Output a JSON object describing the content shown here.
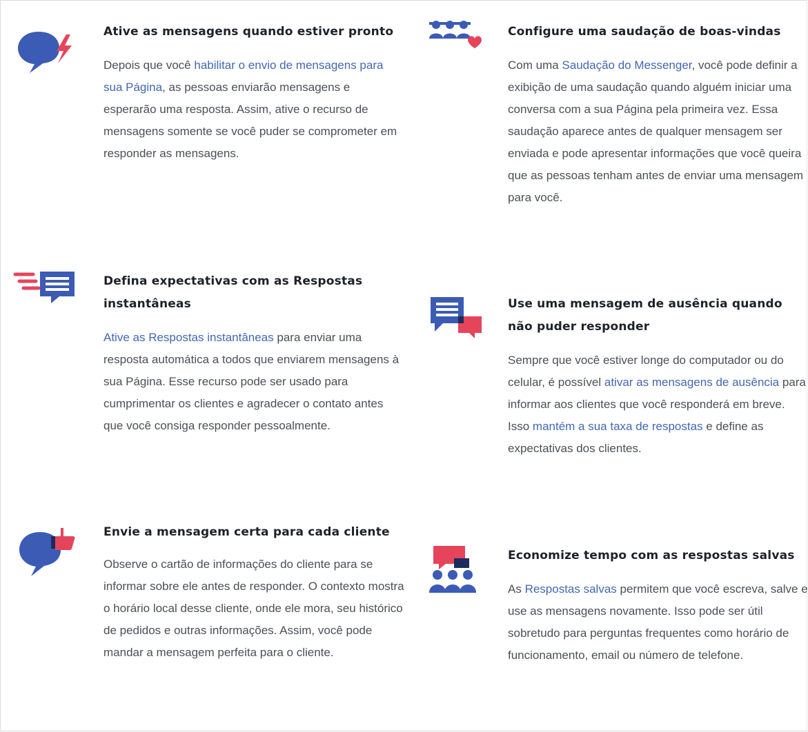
{
  "colors": {
    "link": "#4267b2",
    "icon_blue": "#3b5bb5",
    "icon_red": "#e5445b",
    "title": "#1d2129",
    "body": "#4b4f56"
  },
  "features": [
    {
      "icon": "chat-bubble-lightning-icon",
      "title": "Ative as mensagens quando estiver pronto",
      "body": [
        {
          "t": "Depois que você "
        },
        {
          "t": "habilitar o envio de mensagens para sua Página",
          "link": true
        },
        {
          "t": ", as pessoas enviarão mensagens e esperarão uma resposta. Assim, ative o recurso de mensagens somente se você puder se comprometer em responder as mensagens."
        }
      ]
    },
    {
      "icon": "instant-reply-icon",
      "title": "Defina expectativas com as Respostas instantâneas",
      "body": [
        {
          "t": "Ative as Respostas instantâneas",
          "link": true
        },
        {
          "t": " para enviar uma resposta automática a todos que enviarem mensagens à sua Página. Esse recurso pode ser usado para cumprimentar os clientes e agradecer o contato antes que você consiga responder pessoalmente."
        }
      ]
    },
    {
      "icon": "chat-bubble-thumbs-up-icon",
      "title": "Envie a mensagem certa para cada cliente",
      "body": [
        {
          "t": "Observe o cartão de informações do cliente para se informar sobre ele antes de responder. O contexto mostra o horário local desse cliente, onde ele mora, seu histórico de pedidos e outras informações. Assim, você pode mandar a mensagem perfeita para o cliente."
        }
      ]
    },
    {
      "icon": "people-heart-icon",
      "title": "Configure uma saudação de boas-vindas",
      "body": [
        {
          "t": "Com uma "
        },
        {
          "t": "Saudação do Messenger",
          "link": true
        },
        {
          "t": ", você pode definir a exibição de uma saudação quando alguém iniciar uma conversa com a sua Página pela primeira vez. Essa saudação aparece antes de qualquer mensagem ser enviada e pode apresentar informações que você queira que as pessoas tenham antes de enviar uma mensagem para você."
        }
      ]
    },
    {
      "icon": "away-message-icon",
      "title": "Use uma mensagem de ausência quando não puder responder",
      "body": [
        {
          "t": "Sempre que você estiver longe do computador ou do celular, é possível "
        },
        {
          "t": "ativar as mensagens de ausência",
          "link": true
        },
        {
          "t": " para informar aos clientes que você responderá em breve. Isso "
        },
        {
          "t": "mantém a sua taxa de respostas",
          "link": true
        },
        {
          "t": " e define as expectativas dos clientes."
        }
      ]
    },
    {
      "icon": "saved-replies-group-icon",
      "title": "Economize tempo com as respostas salvas",
      "body": [
        {
          "t": "As "
        },
        {
          "t": "Respostas salvas",
          "link": true
        },
        {
          "t": " permitem que você escreva, salve e use as mensagens novamente. Isso pode ser útil sobretudo para perguntas frequentes como horário de funcionamento, email ou número de telefone."
        }
      ]
    }
  ]
}
